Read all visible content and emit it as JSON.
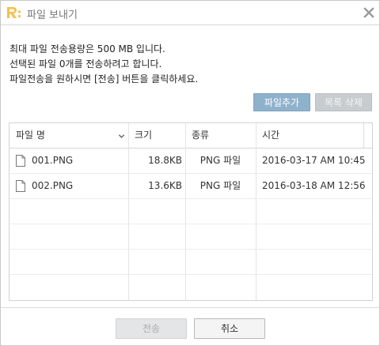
{
  "window": {
    "title": "파일 보내기",
    "logo_icon": "app-logo-icon",
    "close_icon": "close-icon",
    "accent": "#f2c14e"
  },
  "info": {
    "line1": "최대 파일 전송용량은 500 MB 입니다.",
    "line2": "선택된 파일 0개를 전송하려고 합니다.",
    "line3": "파일전송을 원하시면 [전송] 버튼을 클릭하세요."
  },
  "toolbar": {
    "add_label": "파일추가",
    "delete_label": "목록 삭제"
  },
  "table": {
    "columns": [
      "파일 명",
      "크기",
      "종류",
      "시간"
    ],
    "sort_icon": "chevron-down-icon",
    "rows": [
      {
        "name": "001.PNG",
        "size": "18.8KB",
        "type": "PNG 파일",
        "time": "2016-03-17 AM 10:45"
      },
      {
        "name": "002.PNG",
        "size": "13.6KB",
        "type": "PNG 파일",
        "time": "2016-03-18 AM 12:56"
      }
    ]
  },
  "footer": {
    "send_label": "전송",
    "cancel_label": "취소"
  }
}
